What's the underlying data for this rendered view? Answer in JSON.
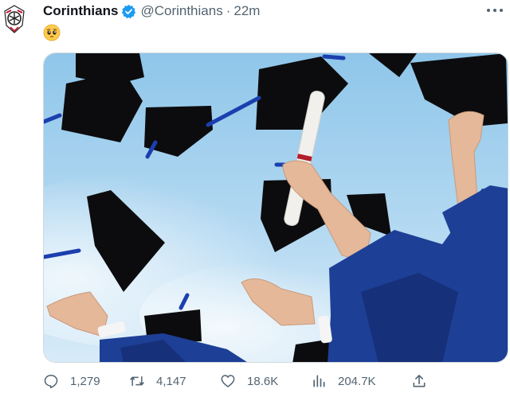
{
  "tweet": {
    "display_name": "Corinthians",
    "handle": "@Corinthians",
    "separator": "·",
    "time": "22m",
    "emoji": "🥺"
  },
  "metrics": {
    "replies": "1,279",
    "retweets": "4,147",
    "likes": "18.6K",
    "views": "204.7K"
  },
  "icons": {
    "avatar": "corinthians-crest",
    "verified": "verified-badge",
    "more": "more-dots-icon",
    "reply": "reply-icon",
    "retweet": "retweet-icon",
    "like": "heart-icon",
    "views": "views-bar-icon",
    "share": "share-icon"
  },
  "colors": {
    "verified": "#1d9bf0",
    "text_secondary": "#536471",
    "sky": "#8fc6ea",
    "gown": "#1e3f96"
  },
  "media": {
    "alt": "graduation-caps-thrown-in-the-air"
  }
}
